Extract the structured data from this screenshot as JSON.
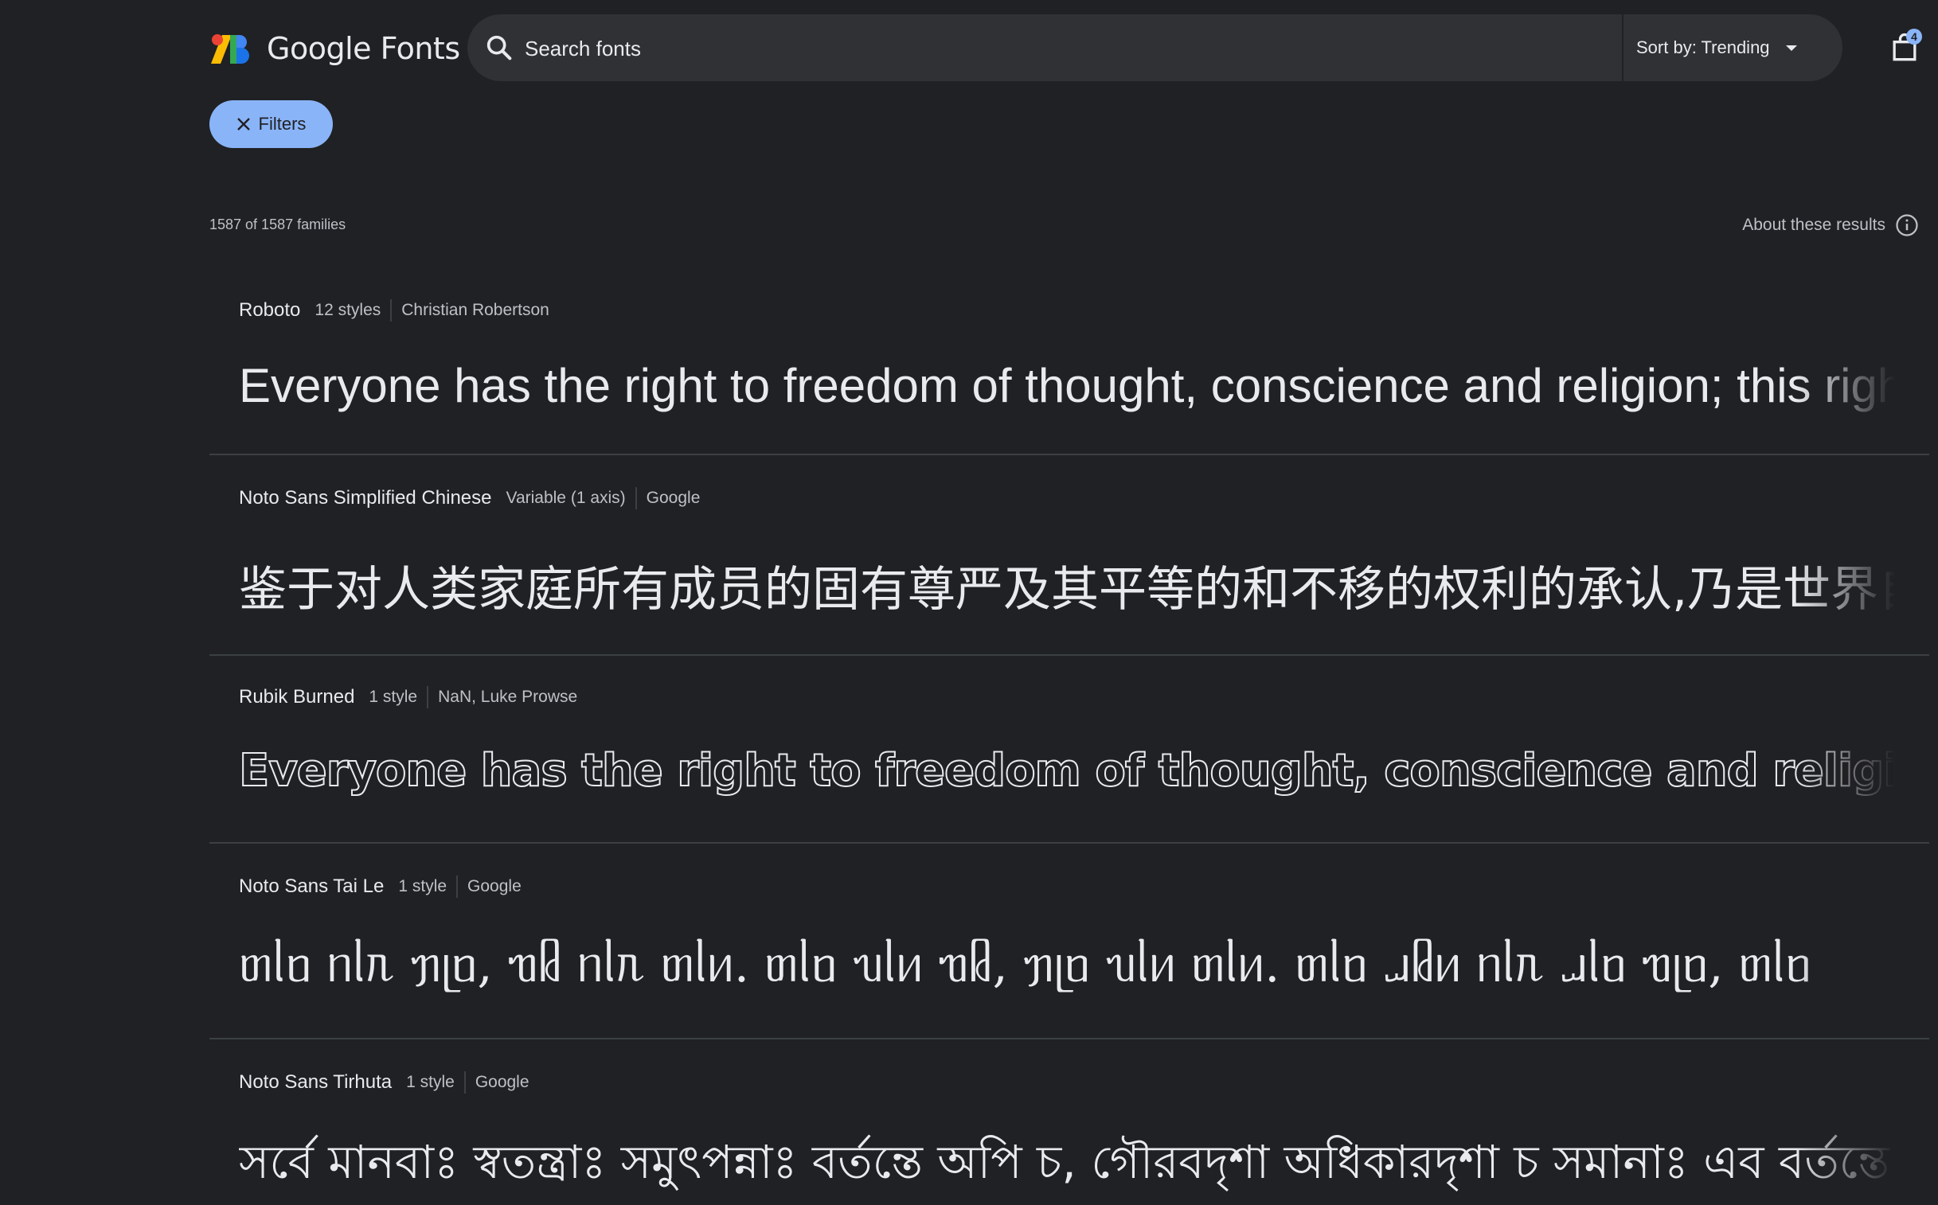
{
  "header": {
    "logo_text": "Google Fonts",
    "search_placeholder": "Search fonts",
    "sort_label": "Sort by: Trending",
    "cart_count": "4"
  },
  "filters": {
    "label": "Filters"
  },
  "results": {
    "count_text": "1587 of 1587 families",
    "about_label": "About these results"
  },
  "colors": {
    "background": "#202124",
    "search_bg": "#303134",
    "accent": "#8ab4f8",
    "divider": "#3c4043"
  },
  "fonts": [
    {
      "name": "Roboto",
      "styles": "12 styles",
      "designer": "Christian Robertson",
      "sample": "Everyone has the right to freedom of thought, conscience and religion; this right"
    },
    {
      "name": "Noto Sans Simplified Chinese",
      "styles": "Variable (1 axis)",
      "designer": "Google",
      "sample": "鉴于对人类家庭所有成员的固有尊严及其平等的和不移的权利的承认,乃是世界自由"
    },
    {
      "name": "Rubik Burned",
      "styles": "1 style",
      "designer": "NaN, Luke Prowse",
      "sample": "Everyone has the right to freedom of thought, conscience and religion"
    },
    {
      "name": "Noto Sans Tai Le",
      "styles": "1 style",
      "designer": "Google",
      "sample": "ᥖᥣᥝ ᥒᥣᥰ ᥟᥨᥝ, ᥓᥤ ᥒᥣᥰ ᥖᥣᥢ. ᥖᥣᥝ ᥔᥣᥢ ᥓᥤ, ᥟᥨᥝ ᥔᥣᥢ ᥖᥣᥢ. ᥖᥣᥝ ᥘᥤᥢ ᥒᥣᥰ ᥘᥣᥝ ᥓᥨᥝ, ᥖᥣᥝ"
    },
    {
      "name": "Noto Sans Tirhuta",
      "styles": "1 style",
      "designer": "Google",
      "sample": "সর্বে মানবাঃ স্বতন্ত্রাঃ সমুৎপন্নাঃ বর্তন্তে অপি চ, গৌরবদৃশা অধিকারদৃশা চ সমানাঃ এব বর্তন্তে"
    }
  ]
}
